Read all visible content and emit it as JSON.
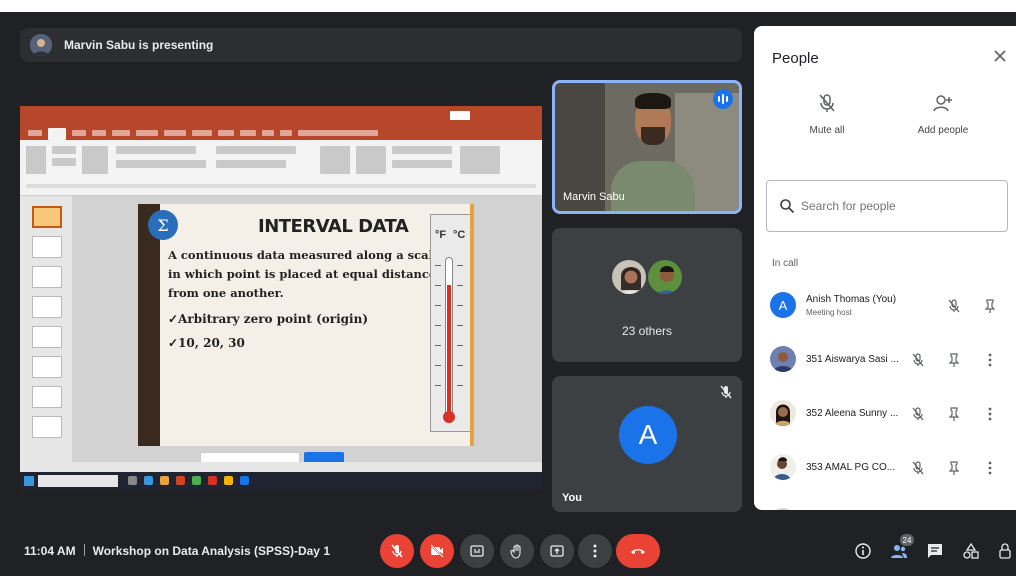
{
  "presenting": {
    "text": "Marvin Sabu is presenting"
  },
  "slide": {
    "heading": "INTERVAL DATA",
    "line1": "A continuous data measured along a scale,",
    "line2": "in which point is placed at equal distance",
    "line3": "from one another.",
    "bullet1": "✓Arbitrary zero point (origin)",
    "bullet2": "✓10, 20, 30",
    "therm_f": "°F",
    "therm_c": "°C"
  },
  "tiles": {
    "presenter_name": "Marvin Sabu",
    "others_count": "23 others",
    "you_initial": "A",
    "you_label": "You"
  },
  "people": {
    "title": "People",
    "mute_all": "Mute all",
    "add_people": "Add people",
    "search_placeholder": "Search for people",
    "section": "In call",
    "participants": [
      {
        "name": "Anish Thomas (You)",
        "role": "Meeting host",
        "initial": "A"
      },
      {
        "name": "351 Aiswarya Sasi ..."
      },
      {
        "name": "352 Aleena Sunny ..."
      },
      {
        "name": "353 AMAL PG CO..."
      }
    ]
  },
  "bottom": {
    "time": "11:04 AM",
    "meeting_title": "Workshop on Data Analysis (SPSS)-Day 1",
    "people_count": "24"
  },
  "colors": {
    "background": "#202124",
    "panel": "#3c4043",
    "accent": "#1a73e8",
    "danger": "#ea4335",
    "ppt": "#b7472a"
  },
  "icons": [
    "mic-off-icon",
    "camera-off-icon",
    "captions-icon",
    "raise-hand-icon",
    "present-icon",
    "more-icon",
    "end-call-icon",
    "info-icon",
    "people-icon",
    "chat-icon",
    "activities-icon",
    "host-controls-icon",
    "close-icon",
    "search-icon",
    "pin-icon",
    "add-person-icon"
  ]
}
